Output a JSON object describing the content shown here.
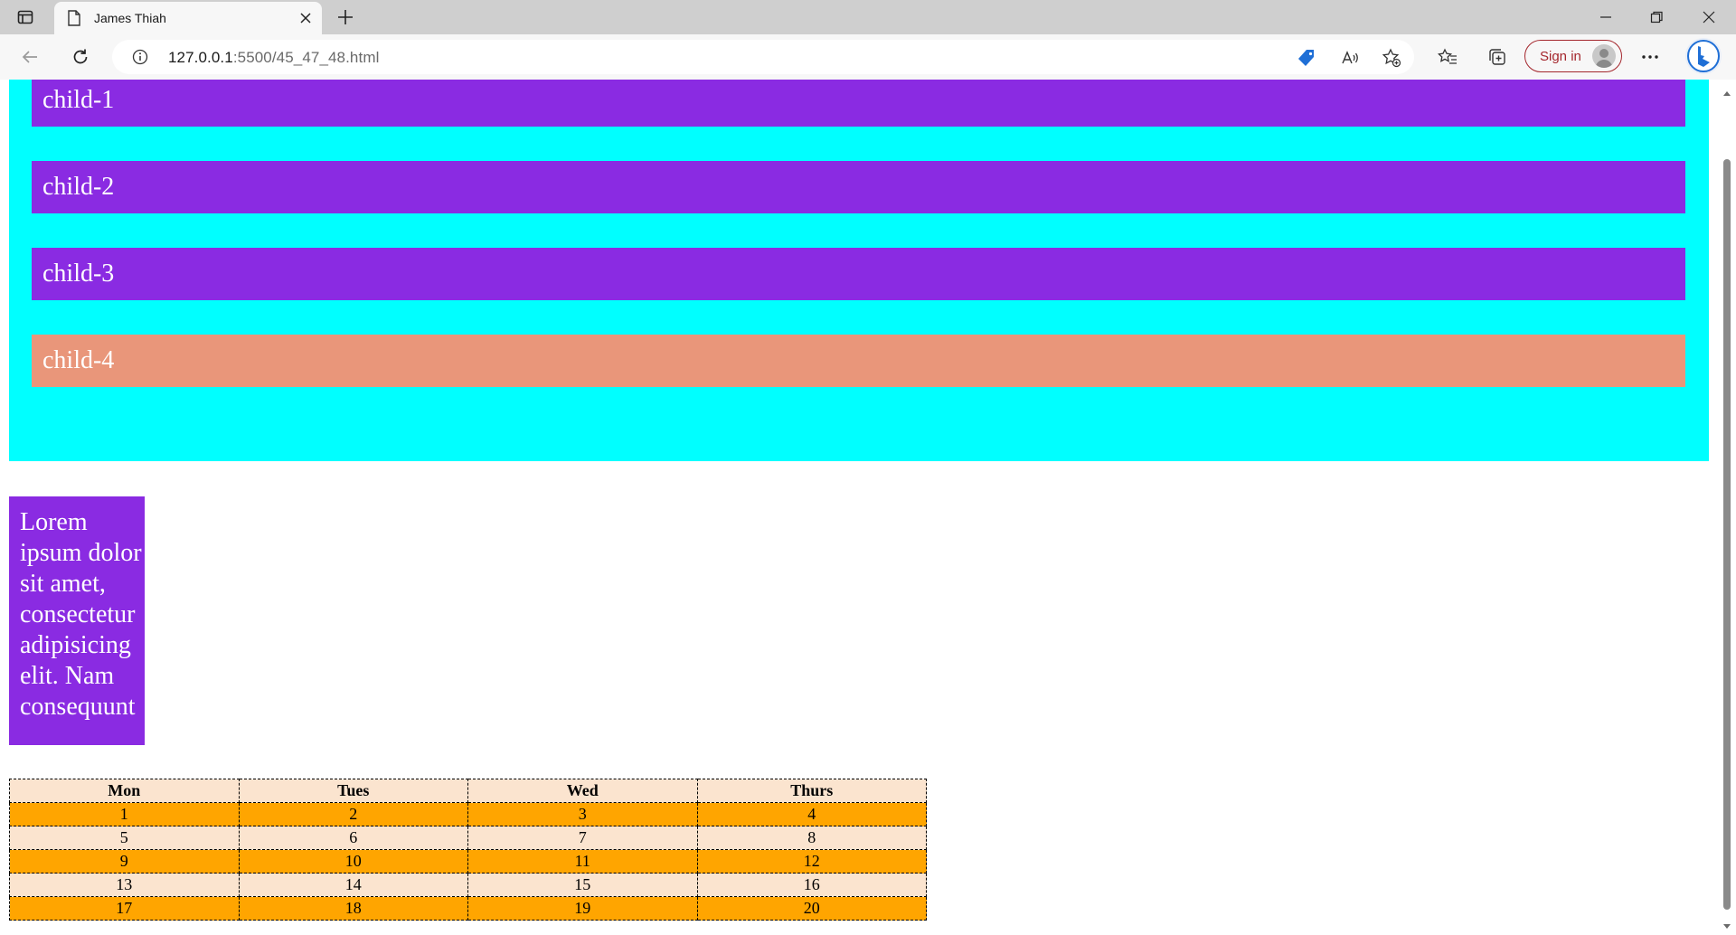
{
  "browser": {
    "tab_title": "James Thiah",
    "url_host": "127.0.0.1",
    "url_rest": ":5500/45_47_48.html",
    "signin_label": "Sign in"
  },
  "icons": {
    "sidebar": "tab-actions-icon",
    "favicon": "document-icon",
    "close": "close-icon",
    "new_tab": "plus-icon",
    "back": "back-arrow-icon",
    "reload": "reload-icon",
    "info": "info-icon",
    "shopping": "shopping-tag-icon",
    "read_aloud": "read-aloud-icon",
    "add_favorite": "add-favorite-icon",
    "favorites": "favorites-icon",
    "collections": "collections-icon",
    "more": "more-icon",
    "bing": "bing-icon"
  },
  "page": {
    "children": [
      {
        "label": "child-1"
      },
      {
        "label": "child-2"
      },
      {
        "label": "child-3"
      },
      {
        "label": "child-4"
      }
    ],
    "lorem_text": "Lorem ipsum dolor sit amet, consectetur adipisicing elit. Nam consequunt",
    "table": {
      "headers": [
        "Mon",
        "Tues",
        "Wed",
        "Thurs"
      ],
      "rows": [
        [
          "1",
          "2",
          "3",
          "4"
        ],
        [
          "5",
          "6",
          "7",
          "8"
        ],
        [
          "9",
          "10",
          "11",
          "12"
        ],
        [
          "13",
          "14",
          "15",
          "16"
        ],
        [
          "17",
          "18",
          "19",
          "20"
        ]
      ]
    }
  },
  "colors": {
    "parent_bg": "#00ffff",
    "child_bg": "#8a2be2",
    "child4_bg": "#e9967a",
    "row_odd": "#ffa500",
    "row_even": "#fbe4cf",
    "accent": "#a4262c"
  }
}
